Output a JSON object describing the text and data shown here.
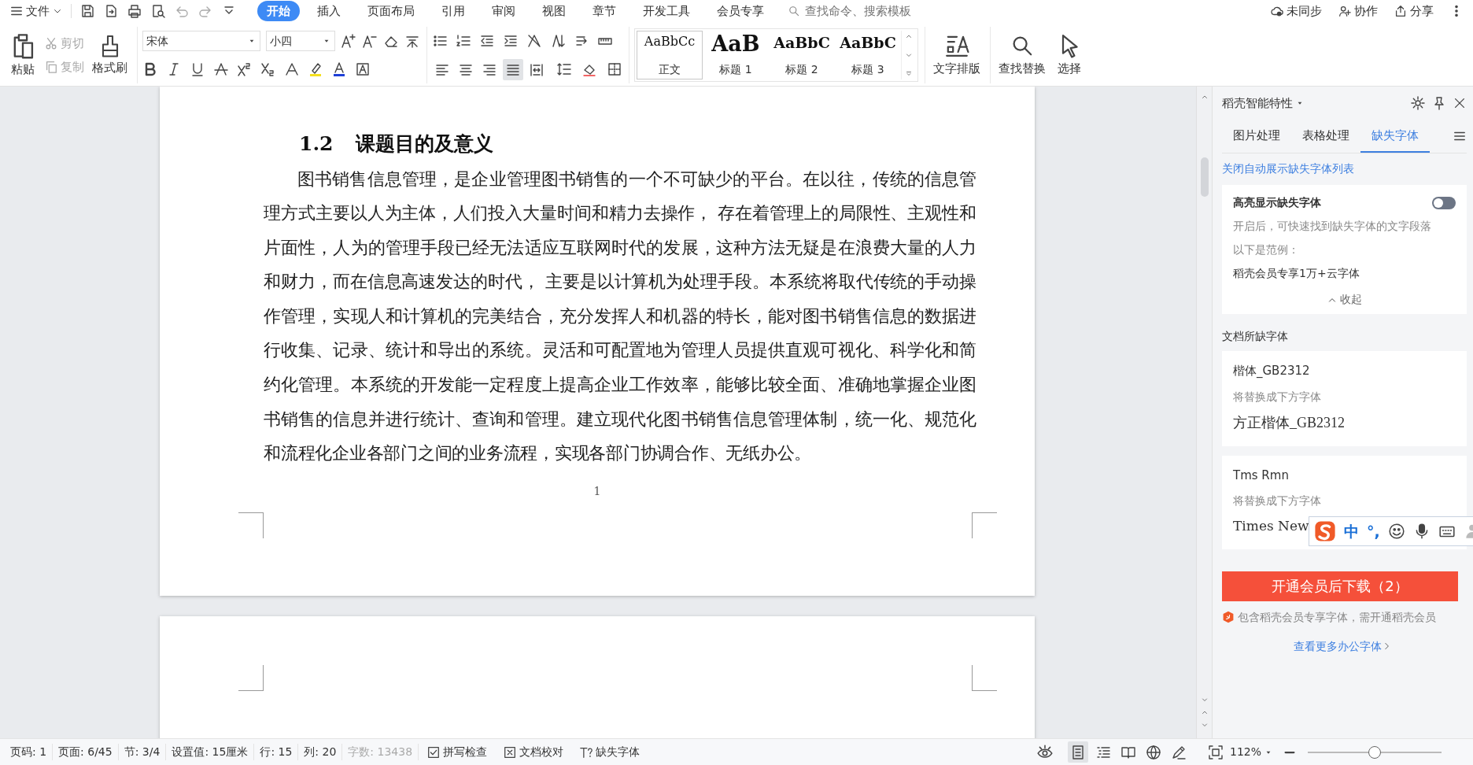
{
  "menu": {
    "file": "文件",
    "tabs": [
      {
        "label": "开始",
        "selected": true
      },
      {
        "label": "插入",
        "selected": false
      },
      {
        "label": "页面布局",
        "selected": false
      },
      {
        "label": "引用",
        "selected": false
      },
      {
        "label": "审阅",
        "selected": false
      },
      {
        "label": "视图",
        "selected": false
      },
      {
        "label": "章节",
        "selected": false
      },
      {
        "label": "开发工具",
        "selected": false
      },
      {
        "label": "会员专享",
        "selected": false
      }
    ],
    "search": {
      "placeholder": "查找命令、搜索模板"
    },
    "actions": [
      {
        "kind": "cloud",
        "label": "未同步"
      },
      {
        "kind": "collab",
        "label": "协作"
      },
      {
        "kind": "share",
        "label": "分享"
      }
    ]
  },
  "ribbon": {
    "paste": "粘贴",
    "cut": {
      "label": "剪切",
      "disabled": true
    },
    "copy": {
      "label": "复制",
      "disabled": true
    },
    "format_painter": "格式刷",
    "font": "宋体",
    "size": "小四",
    "alignment": [
      {
        "kind": "left",
        "selected": false
      },
      {
        "kind": "center",
        "selected": false
      },
      {
        "kind": "right",
        "selected": false
      },
      {
        "kind": "justify",
        "selected": true
      },
      {
        "kind": "distributed",
        "selected": false
      }
    ],
    "styles": [
      {
        "kind": "body",
        "preview": "AaBbCc",
        "label": "正文",
        "selected": true
      },
      {
        "kind": "h1",
        "preview": "AaB",
        "label": "标题 1",
        "selected": false
      },
      {
        "kind": "h2",
        "preview": "AaBbC",
        "label": "标题 2",
        "selected": false
      },
      {
        "kind": "h3",
        "preview": "AaBbC",
        "label": "标题 3",
        "selected": false
      }
    ],
    "text_layout": "文字排版",
    "find_replace": "查找替换",
    "select": "选择"
  },
  "document": {
    "heading_number": "1.2",
    "heading_title": "课题目的及意义",
    "paragraph": "图书销售信息管理，是企业管理图书销售的一个不可缺少的平台。在以往，传统的信息管理方式主要以人为主体，人们投入大量时间和精力去操作， 存在着管理上的局限性、主观性和片面性，人为的管理手段已经无法适应互联网时代的发展，这种方法无疑是在浪费大量的人力和财力，而在信息高速发达的时代， 主要是以计算机为处理手段。本系统将取代传统的手动操作管理，实现人和计算机的完美结合，充分发挥人和机器的特长，能对图书销售信息的数据进行收集、记录、统计和导出的系统。灵活和可配置地为管理人员提供直观可视化、科学化和简约化管理。本系统的开发能一定程度上提高企业工作效率，能够比较全面、准确地掌握企业图书销售的信息并进行统计、查询和管理。建立现代化图书销售信息管理体制，统一化、规范化和流程化企业各部门之间的业务流程，实现各部门协调合作、无纸办公。",
    "page_number": "1"
  },
  "panel": {
    "title": "稻壳智能特性",
    "tabs": [
      {
        "label": "图片处理",
        "selected": false
      },
      {
        "label": "表格处理",
        "selected": false
      },
      {
        "label": "缺失字体",
        "selected": true
      }
    ],
    "link": "关闭自动展示缺失字体列表",
    "highlight": {
      "label": "高亮显示缺失字体",
      "on": false,
      "description": "开启后，可快速找到缺失字体的文字段落",
      "example_label": "以下是范例：",
      "example": "稻壳会员专享1万+云字体",
      "collapse": "收起"
    },
    "section_title": "文档所缺字体",
    "fonts": [
      {
        "kind": "kai",
        "missing": "楷体_GB2312",
        "note": "将替换成下方字体",
        "replacement": "方正楷体_GB2312"
      },
      {
        "kind": "serif",
        "missing": "Tms Rmn",
        "note": "将替换成下方字体",
        "replacement": "Times New"
      }
    ],
    "ime": {
      "mode": "中",
      "punct": "°,"
    },
    "download": "开通会员后下载（2）",
    "notice": "包含稻壳会员专享字体，需开通稻壳会员",
    "more": "查看更多办公字体"
  },
  "status": {
    "items": [
      "页码: 1",
      "页面: 6/45",
      "节: 3/4",
      "设置值: 15厘米",
      "行: 15",
      "列: 20"
    ],
    "word_count": "字数: 13438",
    "spell": "拼写检查",
    "proofread": "文档校对",
    "missing_fonts": "缺失字体",
    "views": [
      {
        "kind": "page",
        "selected": true
      },
      {
        "kind": "outline",
        "selected": false
      },
      {
        "kind": "read",
        "selected": false
      },
      {
        "kind": "web",
        "selected": false
      },
      {
        "kind": "write",
        "selected": false
      }
    ],
    "zoom": "112%",
    "zoom_slider": {
      "level": 0.5
    }
  }
}
